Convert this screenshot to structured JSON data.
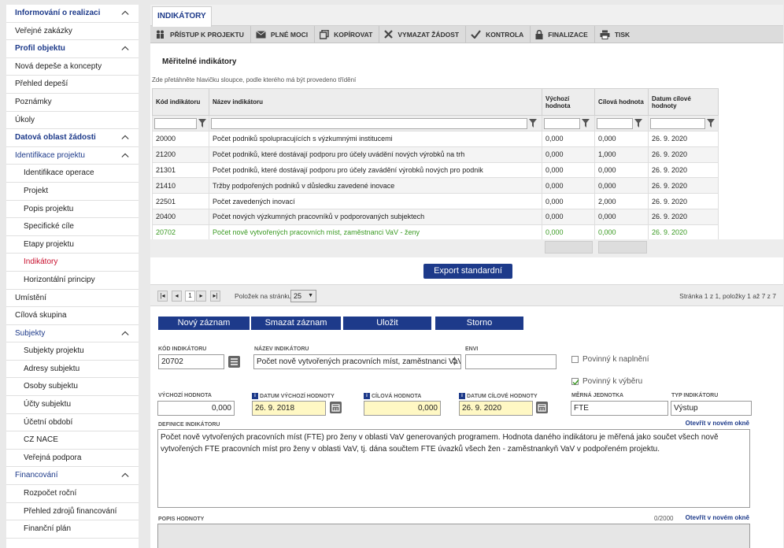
{
  "sidebar": {
    "items": [
      {
        "label": "Informování o realizaci",
        "kind": "sec",
        "chev": true
      },
      {
        "label": "Veřejné zakázky",
        "kind": "item"
      },
      {
        "label": "Profil objektu",
        "kind": "sec",
        "chev": true
      },
      {
        "label": "Nová depeše a koncepty",
        "kind": "item"
      },
      {
        "label": "Přehled depeší",
        "kind": "item"
      },
      {
        "label": "Poznámky",
        "kind": "item"
      },
      {
        "label": "Úkoly",
        "kind": "item"
      },
      {
        "label": "Datová oblast žádosti",
        "kind": "sec",
        "chev": true
      },
      {
        "label": "Identifikace projektu",
        "kind": "blue",
        "chev": true
      },
      {
        "label": "Identifikace operace",
        "kind": "sub"
      },
      {
        "label": "Projekt",
        "kind": "sub"
      },
      {
        "label": "Popis projektu",
        "kind": "sub"
      },
      {
        "label": "Specifické cíle",
        "kind": "sub"
      },
      {
        "label": "Etapy projektu",
        "kind": "sub"
      },
      {
        "label": "Indikátory",
        "kind": "sub active"
      },
      {
        "label": "Horizontální principy",
        "kind": "sub"
      },
      {
        "label": "Umístění",
        "kind": "item"
      },
      {
        "label": "Cílová skupina",
        "kind": "item"
      },
      {
        "label": "Subjekty",
        "kind": "blue",
        "chev": true
      },
      {
        "label": "Subjekty projektu",
        "kind": "sub"
      },
      {
        "label": "Adresy subjektu",
        "kind": "sub"
      },
      {
        "label": "Osoby subjektu",
        "kind": "sub"
      },
      {
        "label": "Účty subjektu",
        "kind": "sub"
      },
      {
        "label": "Účetní období",
        "kind": "sub"
      },
      {
        "label": "CZ NACE",
        "kind": "sub"
      },
      {
        "label": "Veřejná podpora",
        "kind": "sub"
      },
      {
        "label": "Financování",
        "kind": "blue",
        "chev": true
      },
      {
        "label": "Rozpočet roční",
        "kind": "sub"
      },
      {
        "label": "Přehled zdrojů financování",
        "kind": "sub"
      },
      {
        "label": "Finanční plán",
        "kind": "sub"
      }
    ]
  },
  "tab": {
    "label": "INDIKÁTORY"
  },
  "toolbar": {
    "access": "PŘÍSTUP K PROJEKTU",
    "power": "PLNÉ MOCI",
    "copy": "KOPÍROVAT",
    "delete": "VYMAZAT ŽÁDOST",
    "check": "KONTROLA",
    "finalize": "FINALIZACE",
    "print": "TISK"
  },
  "section": {
    "title": "Měřitelné indikátory",
    "hint": "Zde přetáhněte hlavičku sloupce, podle kterého má být provedeno třídění"
  },
  "grid": {
    "headers": [
      "Kód indikátoru",
      "Název indikátoru",
      "Výchozí hodnota",
      "Cílová hodnota",
      "Datum cílové hodnoty"
    ],
    "rows": [
      [
        "20000",
        "Počet podniků spolupracujících s výzkumnými institucemi",
        "0,000",
        "0,000",
        "26. 9. 2020"
      ],
      [
        "21200",
        "Počet podniků, které dostávají podporu pro účely uvádění nových výrobků na trh",
        "0,000",
        "1,000",
        "26. 9. 2020"
      ],
      [
        "21301",
        "Počet podniků, které dostávají podporu pro účely zavádění výrobků nových pro podnik",
        "0,000",
        "0,000",
        "26. 9. 2020"
      ],
      [
        "21410",
        "Tržby podpořených podniků v důsledku zavedené inovace",
        "0,000",
        "0,000",
        "26. 9. 2020"
      ],
      [
        "22501",
        "Počet zavedených inovací",
        "0,000",
        "2,000",
        "26. 9. 2020"
      ],
      [
        "20400",
        "Počet nových výzkumných pracovníků v podporovaných subjektech",
        "0,000",
        "0,000",
        "26. 9. 2020"
      ],
      [
        "20702",
        "Počet nově vytvořených pracovních míst, zaměstnanci VaV - ženy",
        "0,000",
        "0,000",
        "26. 9. 2020"
      ]
    ]
  },
  "export": {
    "label": "Export standardní"
  },
  "pager": {
    "page": "1",
    "per_page_label": "Položek na stránku",
    "per_page": "25",
    "summary": "Stránka 1 z 1, položky 1 až 7 z 7"
  },
  "actions": {
    "new": "Nový záznam",
    "remove": "Smazat záznam",
    "save": "Uložit",
    "cancel": "Storno"
  },
  "form": {
    "code_label": "KÓD INDIKÁTORU",
    "code": "20702",
    "name_label": "NÁZEV INDIKÁTORU",
    "name": "Počet nově vytvořených pracovních míst, zaměstnanci VaV - ženy",
    "envi_label": "ENVI",
    "envi": "",
    "mandatory_fill": "Povinný k naplnění",
    "mandatory_select": "Povinný k výběru",
    "start_value_label": "VÝCHOZÍ HODNOTA",
    "start_value": "0,000",
    "start_date_label": "DATUM VÝCHOZÍ HODNOTY",
    "start_date": "26. 9. 2018",
    "target_value_label": "CÍLOVÁ HODNOTA",
    "target_value": "0,000",
    "target_date_label": "DATUM CÍLOVÉ HODNOTY",
    "target_date": "26. 9. 2020",
    "unit_label": "MĚRNÁ JEDNOTKA",
    "unit": "FTE",
    "type_label": "TYP INDIKÁTORU",
    "type": "Výstup",
    "definition_label": "DEFINICE INDIKÁTORU",
    "open_new_window": "Otevřít v novém okně",
    "definition": "Počet nově vytvořených pracovních míst (FTE) pro ženy v oblasti VaV generovaných programem. Hodnota daného indikátoru je měřená jako součet všech nově vytvořených FTE pracovních míst pro ženy v oblasti VaV, tj. dána součtem FTE úvazků všech žen - zaměstnankyň VaV v podpořeném projektu.",
    "value_desc_label": "POPIS HODNOTY",
    "char_count": "0/2000",
    "open_new_window2": "Otevřít v novém okně"
  },
  "colors": {
    "accent": "#1d3a8a",
    "active": "#c8102e",
    "highlight_row": "#3a9a22",
    "required_bg": "#fff8c4"
  }
}
